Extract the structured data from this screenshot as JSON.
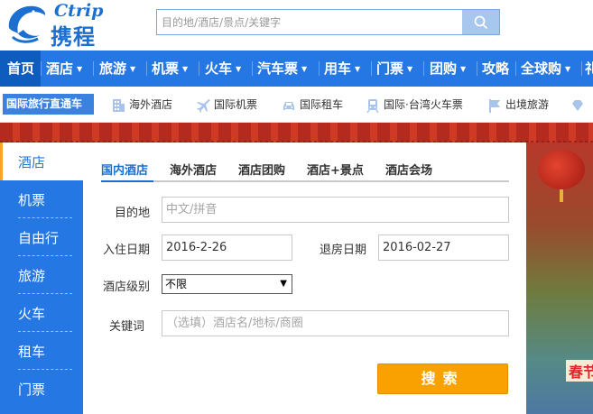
{
  "brand": {
    "name_en": "Ctrip",
    "name_cn": "携程",
    "accent": "#2577e3",
    "cta": "#f8a100"
  },
  "search": {
    "placeholder": "目的地/酒店/景点/关键字",
    "icon": "search-icon"
  },
  "nav": {
    "items": [
      {
        "label": "首页",
        "has_menu": false,
        "active": true
      },
      {
        "label": "酒店",
        "has_menu": true
      },
      {
        "label": "旅游",
        "has_menu": true
      },
      {
        "label": "机票",
        "has_menu": true
      },
      {
        "label": "火车",
        "has_menu": true
      },
      {
        "label": "汽车票",
        "has_menu": true
      },
      {
        "label": "用车",
        "has_menu": true
      },
      {
        "label": "门票",
        "has_menu": true
      },
      {
        "label": "团购",
        "has_menu": true
      },
      {
        "label": "攻略",
        "has_menu": false
      },
      {
        "label": "全球购",
        "has_menu": true
      },
      {
        "label": "礼",
        "has_menu": false
      }
    ],
    "caret": "▼"
  },
  "subnav": {
    "label": "国际旅行直通车",
    "items": [
      {
        "label": "海外酒店",
        "icon": "building-icon"
      },
      {
        "label": "国际机票",
        "icon": "airplane-icon"
      },
      {
        "label": "国际租车",
        "icon": "car-icon"
      },
      {
        "label": "国际·台湾火车票",
        "icon": "train-icon"
      },
      {
        "label": "出境旅游",
        "icon": "flag-icon"
      }
    ]
  },
  "banner": {
    "text": "春节"
  },
  "sidebar": {
    "active": "酒店",
    "items": [
      "机票",
      "自由行",
      "旅游",
      "火车",
      "租车",
      "门票"
    ]
  },
  "form": {
    "tabs": [
      "国内酒店",
      "海外酒店",
      "酒店团购",
      "酒店+景点",
      "酒店会场"
    ],
    "destination": {
      "label": "目的地",
      "placeholder": "中文/拼音"
    },
    "checkin": {
      "label": "入住日期",
      "value": "2016-2-26"
    },
    "checkout": {
      "label": "退房日期",
      "value": "2016-02-27"
    },
    "level": {
      "label": "酒店级别",
      "value": "不限",
      "arrow": "▼"
    },
    "keyword": {
      "label": "关键词",
      "placeholder": "（选填）酒店名/地标/商圈"
    },
    "submit_label": "搜索"
  }
}
